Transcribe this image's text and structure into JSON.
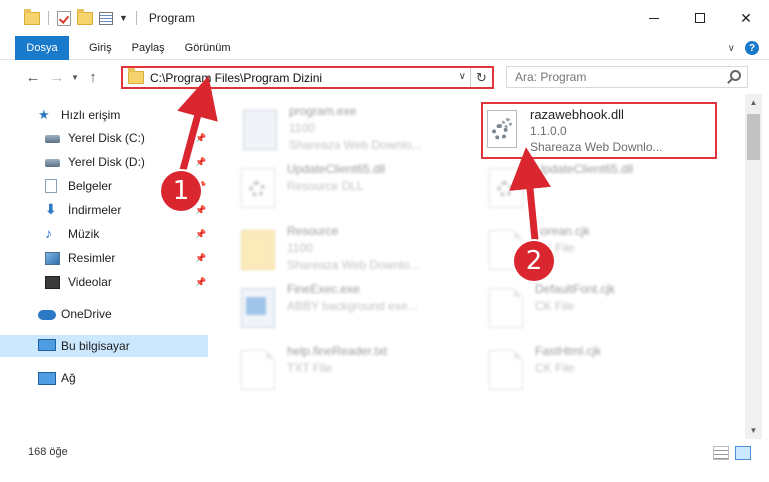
{
  "window": {
    "title": "Program"
  },
  "ribbon": {
    "tabs": [
      "Dosya",
      "Giriş",
      "Paylaş",
      "Görünüm"
    ]
  },
  "nav": {
    "address": "C:\\Program Files\\Program Dizini",
    "search_placeholder": "Ara: Program"
  },
  "sidebar": {
    "quick_access": "Hızlı erişim",
    "items": [
      {
        "label": "Yerel Disk (C:)",
        "icon": "drive-icon"
      },
      {
        "label": "Yerel Disk (D:)",
        "icon": "drive-icon"
      },
      {
        "label": "Belgeler",
        "icon": "documents-icon"
      },
      {
        "label": "İndirmeler",
        "icon": "downloads-icon"
      },
      {
        "label": "Müzik",
        "icon": "music-icon"
      },
      {
        "label": "Resimler",
        "icon": "pictures-icon"
      },
      {
        "label": "Videolar",
        "icon": "videos-icon"
      }
    ],
    "onedrive": "OneDrive",
    "this_pc": "Bu bilgisayar",
    "network": "Ağ"
  },
  "files": [
    {
      "name": "program.exe",
      "line2": "1100",
      "line3": "Shareaza Web Downlo...",
      "icon": "exe-icon",
      "blurred": true
    },
    {
      "name": "razawebhook.dll",
      "line2": "1.1.0.0",
      "line3": "Shareaza Web Downlo...",
      "icon": "dll-gear-icon",
      "blurred": false
    },
    {
      "name": "UpdateClient65.dll",
      "line2": "Resource DLL",
      "line3": "",
      "icon": "dll-gear-icon",
      "blurred": true
    },
    {
      "name": "UpdateClient65.dll",
      "line2": "",
      "line3": "",
      "icon": "dll-gear-icon",
      "blurred": true
    },
    {
      "name": "Resource",
      "line2": "1100",
      "line3": "Shareaza Web Downlo...",
      "icon": "folder-icon",
      "blurred": true
    },
    {
      "name": "korean.cjk",
      "line2": "CK File",
      "line3": "",
      "icon": "file-icon",
      "blurred": true
    },
    {
      "name": "FineExec.exe",
      "line2": "ABBY background exe...",
      "line3": "",
      "icon": "exe-icon",
      "blurred": true
    },
    {
      "name": "DefaultFont.cjk",
      "line2": "CK File",
      "line3": "",
      "icon": "file-icon",
      "blurred": true
    },
    {
      "name": "help.fineReader.txt",
      "line2": "TXT File",
      "line3": "",
      "icon": "file-icon",
      "blurred": true
    },
    {
      "name": "FastHtml.cjk",
      "line2": "CK File",
      "line3": "",
      "icon": "file-icon",
      "blurred": true
    }
  ],
  "status": {
    "count": "168 öğe"
  },
  "annotations": {
    "badge1": "1",
    "badge2": "2",
    "color": "#d9262f"
  }
}
